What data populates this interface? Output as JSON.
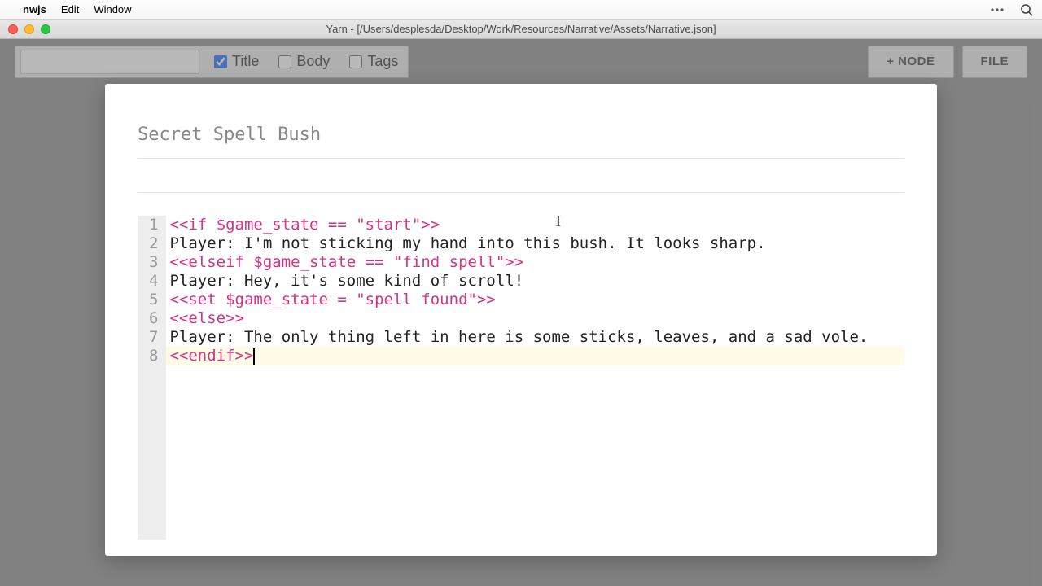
{
  "menubar": {
    "app_name": "nwjs",
    "items": [
      "Edit",
      "Window"
    ]
  },
  "window": {
    "title": "Yarn - [/Users/desplesda/Desktop/Work/Resources/Narrative/Assets/Narrative.json]"
  },
  "toolbar": {
    "search_value": "",
    "filters": {
      "title": {
        "label": "Title",
        "checked": true
      },
      "body": {
        "label": "Body",
        "checked": false
      },
      "tags": {
        "label": "Tags",
        "checked": false
      }
    },
    "add_node_label": "+ NODE",
    "file_label": "FILE"
  },
  "editor": {
    "title": "Secret Spell Bush",
    "lines": [
      {
        "n": "1",
        "tokens": [
          {
            "c": "cmd",
            "t": "<<if $game_state == "
          },
          {
            "c": "str",
            "t": "\"start\""
          },
          {
            "c": "cmd",
            "t": ">>"
          }
        ]
      },
      {
        "n": "2",
        "tokens": [
          {
            "c": "plain",
            "t": "Player: I'm not sticking my hand into this bush. It looks sharp."
          }
        ]
      },
      {
        "n": "3",
        "tokens": [
          {
            "c": "cmd",
            "t": "<<elseif $game_state == "
          },
          {
            "c": "str",
            "t": "\"find spell\""
          },
          {
            "c": "cmd",
            "t": ">>"
          }
        ]
      },
      {
        "n": "4",
        "tokens": [
          {
            "c": "plain",
            "t": "Player: Hey, it's some kind of scroll!"
          }
        ]
      },
      {
        "n": "5",
        "tokens": [
          {
            "c": "cmd",
            "t": "<<set $game_state = "
          },
          {
            "c": "str",
            "t": "\"spell found\""
          },
          {
            "c": "cmd",
            "t": ">>"
          }
        ]
      },
      {
        "n": "6",
        "tokens": [
          {
            "c": "cmd",
            "t": "<<else>>"
          }
        ]
      },
      {
        "n": "7",
        "tokens": [
          {
            "c": "plain",
            "t": "Player: The only thing left in here is some sticks, leaves, and a sad vole."
          }
        ]
      },
      {
        "n": "8",
        "tokens": [
          {
            "c": "cmd",
            "t": "<<endif>>"
          }
        ],
        "active": true,
        "caret_after": true
      }
    ]
  }
}
